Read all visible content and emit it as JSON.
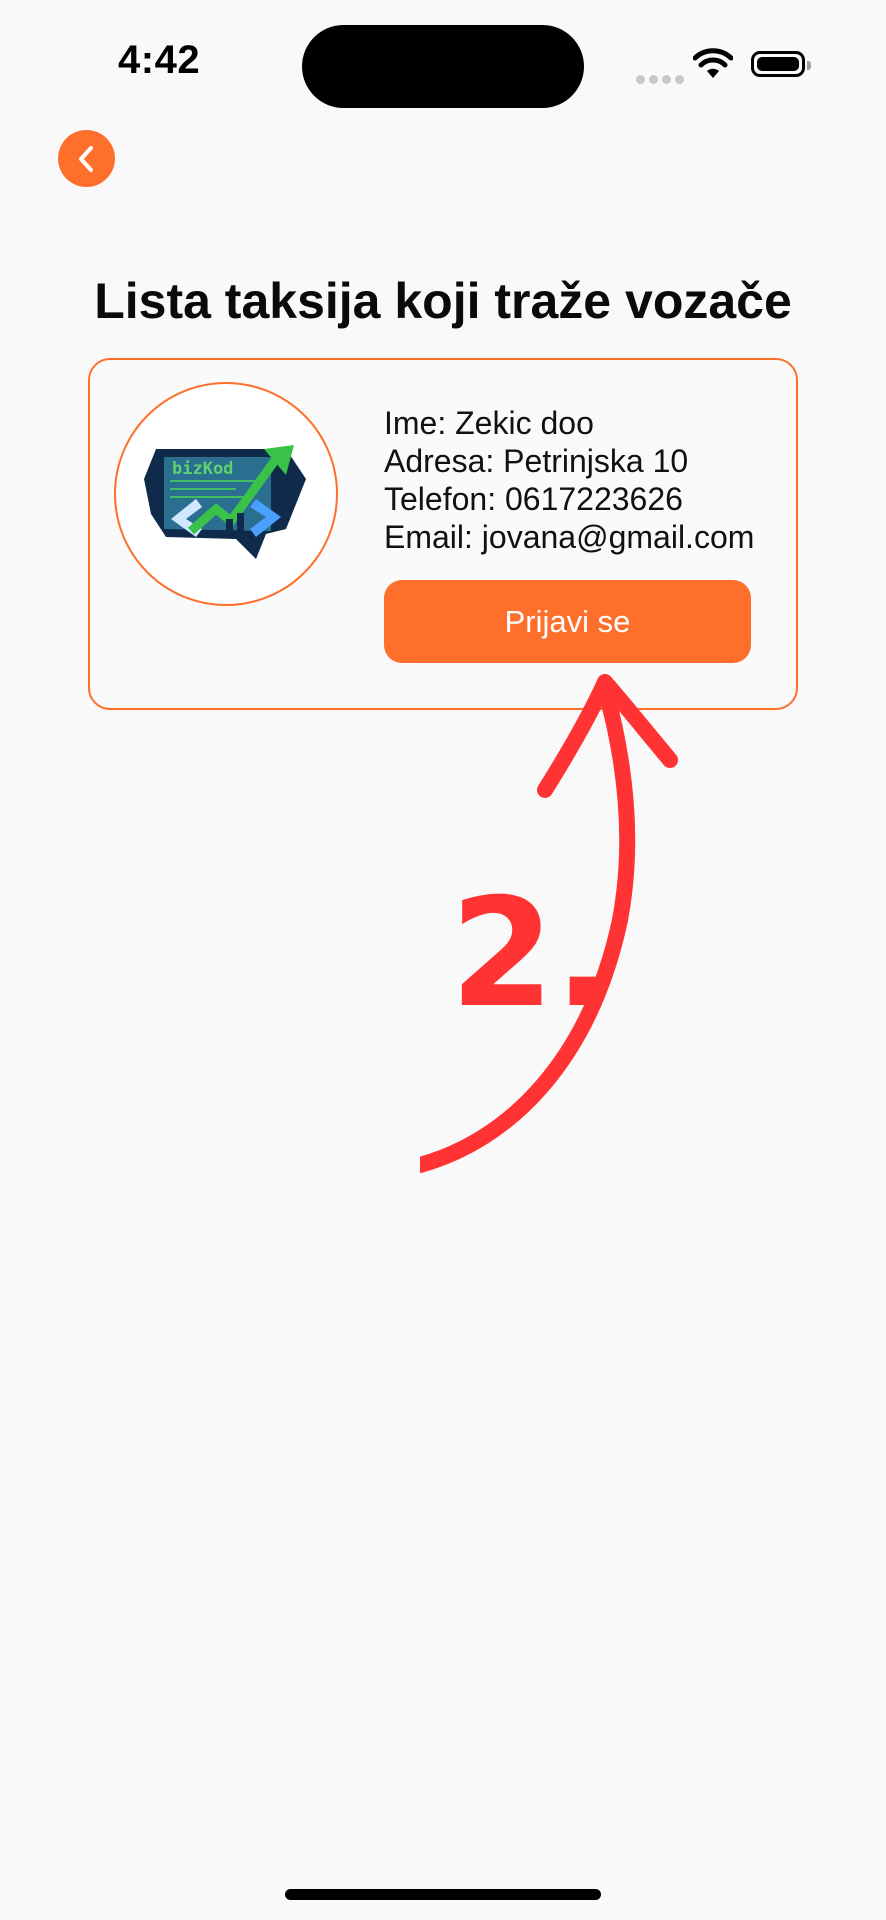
{
  "status_bar": {
    "time": "4:42"
  },
  "header": {
    "back_icon": "chevron-left-icon",
    "title": "Lista taksija koji traže vozače"
  },
  "company_card": {
    "logo_text": "bizKod",
    "name_line": "Ime: Zekic doo",
    "address_line": "Adresa: Petrinjska 10",
    "phone_line": "Telefon: 0617223626",
    "email_line": "Email: jovana@gmail.com",
    "button_label": "Prijavi se"
  },
  "annotation": {
    "label": "2."
  },
  "colors": {
    "accent": "#ff6f2c",
    "annotation": "#ff3333",
    "background": "#f9f9f9"
  }
}
